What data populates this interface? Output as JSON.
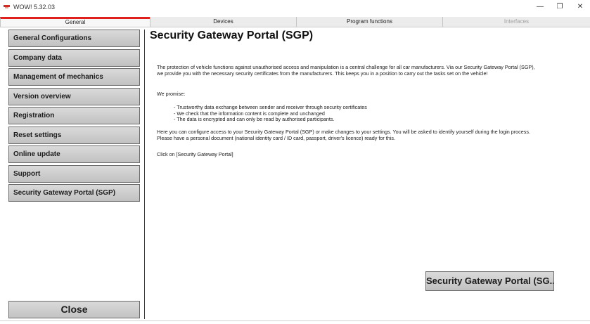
{
  "window": {
    "title": "WOW! 5.32.03",
    "minimize_glyph": "—",
    "maximize_glyph": "❐",
    "close_glyph": "✕"
  },
  "tabs": [
    {
      "label": "General",
      "state": "active"
    },
    {
      "label": "Devices",
      "state": "normal"
    },
    {
      "label": "Program functions",
      "state": "normal"
    },
    {
      "label": "Interfaces",
      "state": "disabled"
    }
  ],
  "sidebar": {
    "items": [
      {
        "label": "General Configurations"
      },
      {
        "label": "Company data"
      },
      {
        "label": "Management of mechanics"
      },
      {
        "label": "Version overview"
      },
      {
        "label": "Registration"
      },
      {
        "label": "Reset settings"
      },
      {
        "label": "Online update"
      },
      {
        "label": "Support"
      },
      {
        "label": "Security Gateway Portal (SGP)"
      }
    ],
    "close_label": "Close"
  },
  "main": {
    "title": "Security Gateway Portal (SGP)",
    "intro": "The protection of vehicle functions against unauthorised access and manipulation is a central challenge for all car manufacturers. Via our Security Gateway Portal (SGP), we provide you with the necessary security certificates from the manufacturers. This keeps you in a position to carry out the tasks set on the vehicle!",
    "promise_heading": "We promise:",
    "promises": [
      "- Trustworthy data exchange between sender and receiver through security certificates",
      "- We check that the information content is complete and unchanged",
      "- The data is encrypted and can only be read by authorised participants."
    ],
    "configure_text": "Here you can configure access to your Security Gateway Portal (SGP) or make changes to your settings. You will be asked to identify yourself during the login process. Please have a personal document (national identity card / ID card, passport, driver's licence) ready for this.",
    "click_hint": "Click on [Security Gateway Portal]",
    "action_button": "Security Gateway Portal (SG..."
  },
  "colors": {
    "accent": "#e0201c",
    "button_top": "#dadada",
    "button_bottom": "#c1c1c1"
  },
  "icons": {
    "app": "wow-logo-icon"
  }
}
